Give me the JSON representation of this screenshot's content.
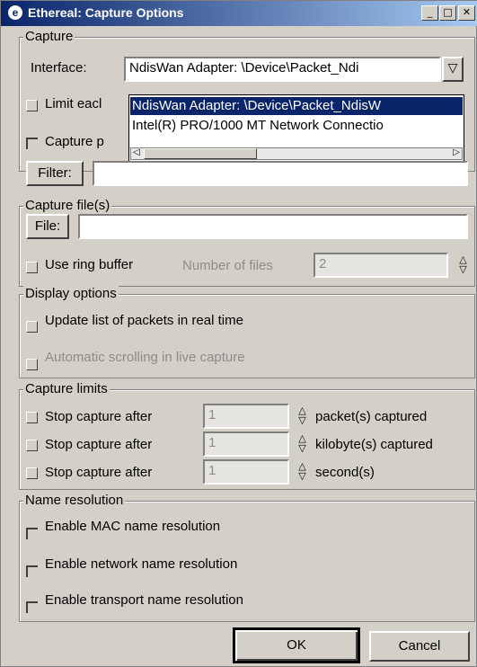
{
  "window": {
    "title": "Ethereal: Capture Options",
    "controls": {
      "minimize": "_",
      "maximize": "□",
      "close": "✕"
    }
  },
  "capture": {
    "legend": "Capture",
    "interface_label": "Interface:",
    "interface_value": "NdisWan Adapter: \\Device\\Packet_Ndi",
    "dropdown_options": [
      "NdisWan Adapter: \\Device\\Packet_NdisW",
      "Intel(R) PRO/1000 MT Network Connectio"
    ],
    "limit_label": "Limit eacl",
    "promisc_label": "Capture p",
    "filter_button": "Filter:",
    "filter_value": ""
  },
  "capture_file": {
    "legend": "Capture file(s)",
    "file_button": "File:",
    "file_value": "",
    "ring_buffer_label": "Use ring buffer",
    "number_of_files_label": "Number of files",
    "number_of_files_value": "2"
  },
  "display_options": {
    "legend": "Display options",
    "update_list_label": "Update list of packets in real time",
    "auto_scroll_label": "Automatic scrolling in live capture"
  },
  "capture_limits": {
    "legend": "Capture limits",
    "rows": [
      {
        "label": "Stop capture after",
        "value": "1",
        "unit": "packet(s) captured"
      },
      {
        "label": "Stop capture after",
        "value": "1",
        "unit": "kilobyte(s) captured"
      },
      {
        "label": "Stop capture after",
        "value": "1",
        "unit": "second(s)"
      }
    ]
  },
  "name_resolution": {
    "legend": "Name resolution",
    "mac_label": "Enable MAC name resolution",
    "network_label": "Enable network name resolution",
    "transport_label": "Enable transport name resolution"
  },
  "buttons": {
    "ok": "OK",
    "cancel": "Cancel"
  }
}
